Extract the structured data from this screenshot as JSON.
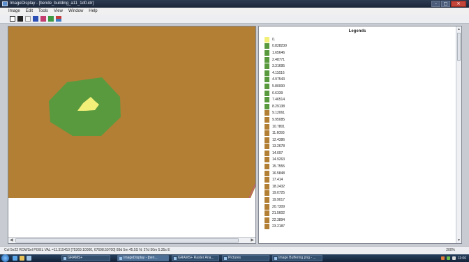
{
  "window": {
    "title": "ImageDisplay - [bende_building_a11_1d0.idr]"
  },
  "menu": [
    "Image",
    "Edit",
    "Tools",
    "View",
    "Window",
    "Help"
  ],
  "map": {
    "colors": {
      "background": "#b27f35",
      "buffer": "#5a9a3e",
      "building": "#f3f07a"
    }
  },
  "legend": {
    "title": "Legends",
    "items": [
      {
        "label": "0.",
        "color": "#f3f07a"
      },
      {
        "label": "0.828230",
        "color": "#5a9a3e"
      },
      {
        "label": "1.65646",
        "color": "#5a9a3e"
      },
      {
        "label": "2.48771",
        "color": "#5a9a3e"
      },
      {
        "label": "3.31695",
        "color": "#5a9a3e"
      },
      {
        "label": "4.11616",
        "color": "#5a9a3e"
      },
      {
        "label": "4.97543",
        "color": "#5a9a3e"
      },
      {
        "label": "5.80000",
        "color": "#5a9a3e"
      },
      {
        "label": "6.6339",
        "color": "#5a9a3e"
      },
      {
        "label": "7.46514",
        "color": "#5a9a3e"
      },
      {
        "label": "8.29138",
        "color": "#5a9a3e"
      },
      {
        "label": "9.12061",
        "color": "#b27f35"
      },
      {
        "label": "9.95085",
        "color": "#b27f35"
      },
      {
        "label": "10.7801",
        "color": "#b27f35"
      },
      {
        "label": "11.6093",
        "color": "#b27f35"
      },
      {
        "label": "12.4386",
        "color": "#b27f35"
      },
      {
        "label": "13.2678",
        "color": "#b27f35"
      },
      {
        "label": "14.097",
        "color": "#b27f35"
      },
      {
        "label": "14.9263",
        "color": "#b27f35"
      },
      {
        "label": "15.7555",
        "color": "#b27f35"
      },
      {
        "label": "16.5848",
        "color": "#b27f35"
      },
      {
        "label": "17.414",
        "color": "#b27f35"
      },
      {
        "label": "18.2432",
        "color": "#b27f35"
      },
      {
        "label": "19.0725",
        "color": "#b27f35"
      },
      {
        "label": "19.9017",
        "color": "#b27f35"
      },
      {
        "label": "20.7309",
        "color": "#b27f35"
      },
      {
        "label": "21.5602",
        "color": "#b27f35"
      },
      {
        "label": "22.3894",
        "color": "#b27f35"
      },
      {
        "label": "23.2187",
        "color": "#b27f35"
      }
    ]
  },
  "status": {
    "text": "Col 5e22  ROWSel  PIXEL VAL =11.315410  [75369.10000, 67698.50700] 89d 5m 45.5S N; 27d 50m 5.35s E",
    "zoom": "200%"
  },
  "taskbar": {
    "items": [
      "GRAMS+",
      "ImageDisplay - [ben...",
      "GRAMS+ Raster Ana...",
      "Pictures",
      "Image Buffering.png - ..."
    ],
    "clock": "11:06"
  }
}
